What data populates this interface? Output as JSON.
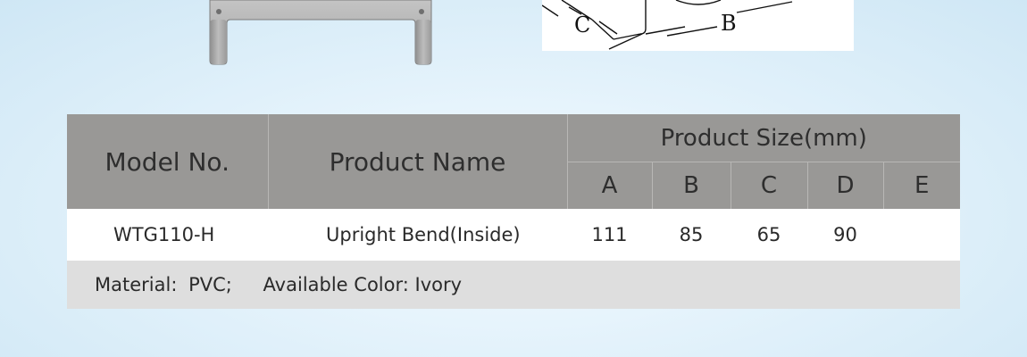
{
  "diagram_labels": {
    "b": "B",
    "c": "C"
  },
  "table": {
    "headers": {
      "model": "Model No.",
      "name": "Product Name",
      "size": "Product Size(mm)",
      "dimensions": [
        "A",
        "B",
        "C",
        "D",
        "E"
      ]
    },
    "row": {
      "model": "WTG110-H",
      "name": "Upright Bend(Inside)",
      "values": [
        "111",
        "85",
        "65",
        "90",
        ""
      ]
    },
    "material": {
      "label": "Material:",
      "value": "PVC;",
      "color_label": "Available Color:",
      "color_value": "Ivory"
    }
  },
  "colors": {
    "header_bg": "#999896",
    "material_bg": "#dedede",
    "product_color": "#b3b3b3"
  }
}
